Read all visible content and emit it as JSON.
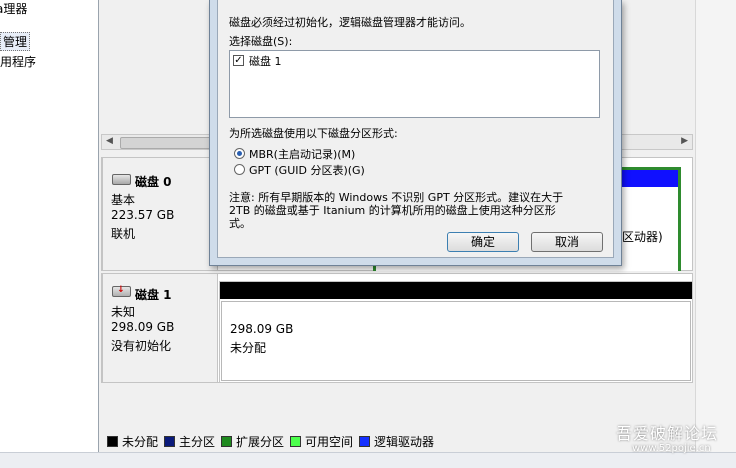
{
  "left_tree": {
    "items": [
      {
        "label": "a理器"
      },
      {
        "label": "管理"
      },
      {
        "label": "用程序"
      }
    ]
  },
  "dialog": {
    "intro": "磁盘必须经过初始化，逻辑磁盘管理器才能访问。",
    "select_label": "选择磁盘(S):",
    "disks": [
      {
        "label": "磁盘 1",
        "checked": true
      }
    ],
    "style_label": "为所选磁盘使用以下磁盘分区形式:",
    "options": [
      {
        "label": "MBR(主启动记录)(M)",
        "selected": true
      },
      {
        "label": "GPT (GUID 分区表)(G)",
        "selected": false
      }
    ],
    "note_lines": [
      "注意: 所有早期版本的 Windows 不识别 GPT 分区形式。建议在大于",
      "2TB 的磁盘或基于 Itanium 的计算机所用的磁盘上使用这种分区形",
      "式。"
    ],
    "ok_label": "确定",
    "cancel_label": "取消"
  },
  "disk0": {
    "title": "磁盘 0",
    "type": "基本",
    "size": "223.57 GB",
    "status": "联机",
    "partition_text": "区动器)"
  },
  "disk1": {
    "title": "磁盘 1",
    "type": "未知",
    "size": "298.09 GB",
    "status": "没有初始化",
    "partition_size": "298.09 GB",
    "partition_status": "未分配"
  },
  "legend": [
    {
      "label": "未分配",
      "color": "#000000"
    },
    {
      "label": "主分区",
      "color": "#0a1a7a"
    },
    {
      "label": "扩展分区",
      "color": "#1f8a1f"
    },
    {
      "label": "可用空间",
      "color": "#4cff4c"
    },
    {
      "label": "逻辑驱动器",
      "color": "#1530ff"
    }
  ],
  "watermark": {
    "line1": "吾爱破解论坛",
    "line2": "www.52pojie.cn"
  }
}
